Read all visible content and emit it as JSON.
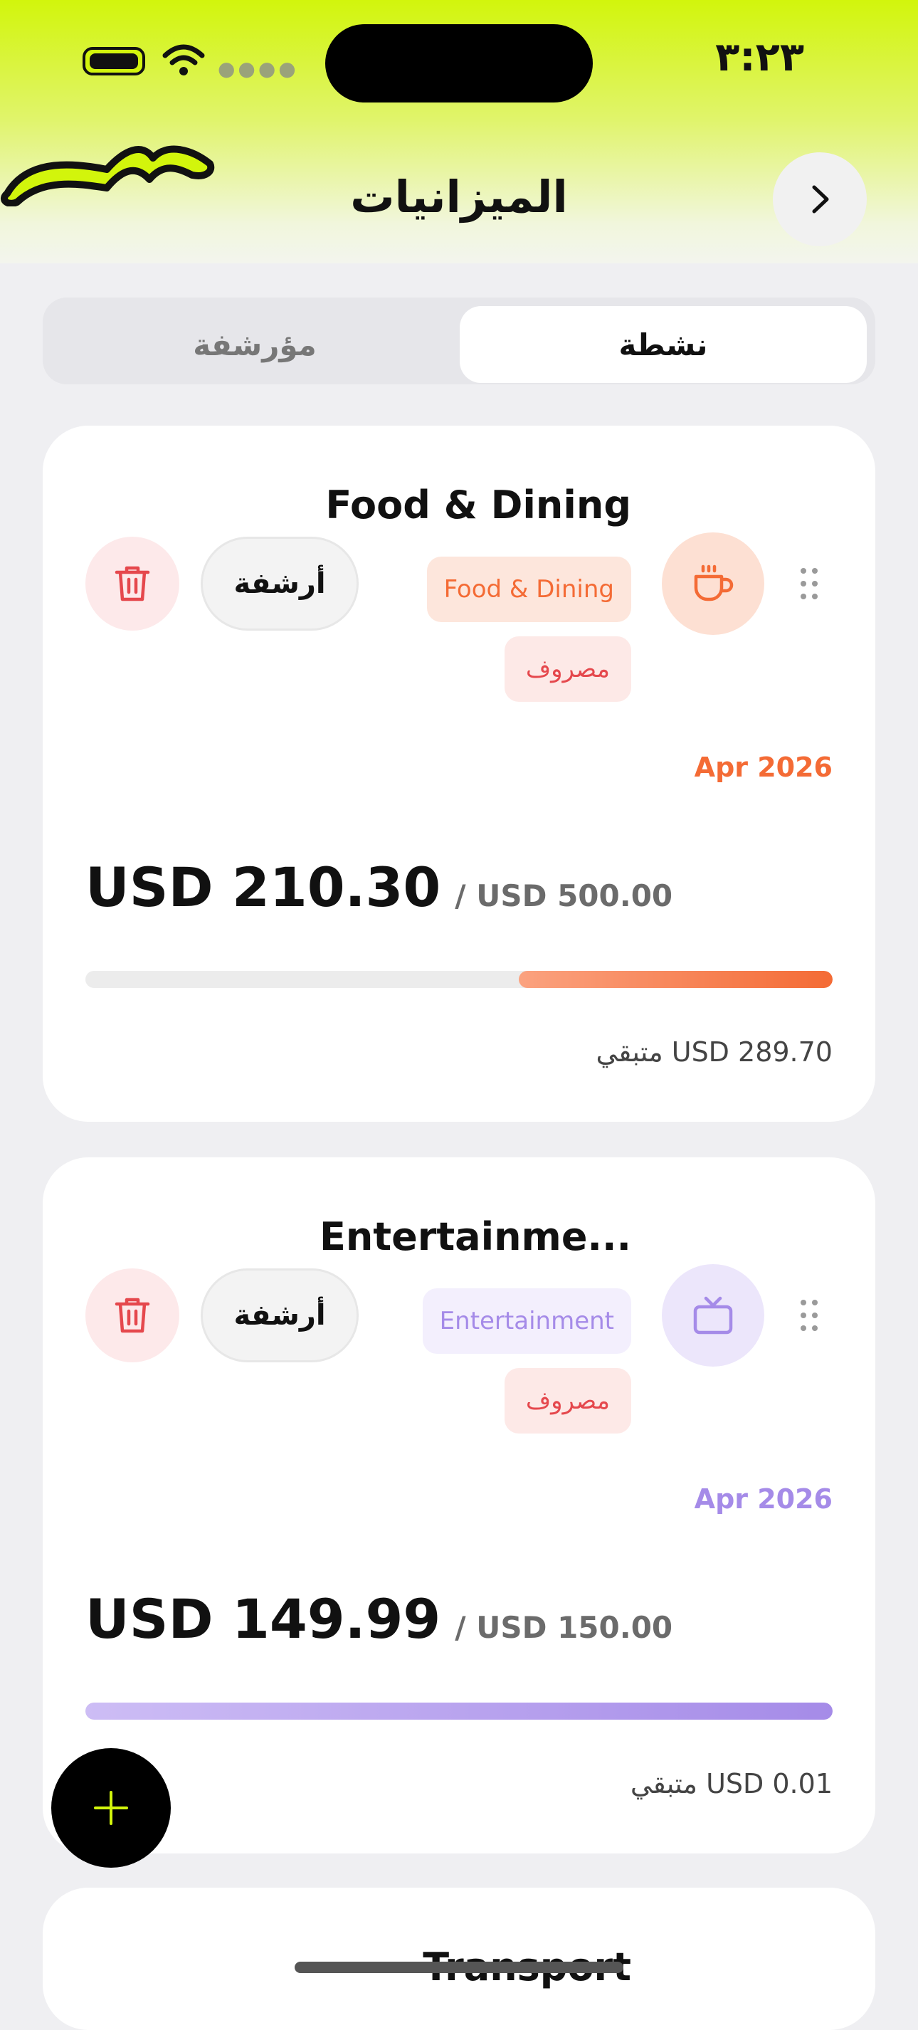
{
  "status_bar": {
    "time": "٣:٢٣"
  },
  "header": {
    "title": "الميزانيات"
  },
  "tabs": [
    {
      "label": "نشطة",
      "active": true
    },
    {
      "label": "مؤرشفة",
      "active": false
    }
  ],
  "budgets": [
    {
      "title": "Food & Dining",
      "category_chip": "Food & Dining",
      "type_chip": "مصروف",
      "icon": "coffee-cup-icon",
      "archive_label": "أرشفة",
      "period": "Apr 2026",
      "spent": "USD 210.30",
      "limit": "/ USD 500.00",
      "progress": 0.42,
      "remaining": "متبقي USD 289.70",
      "accent": "#f46b35"
    },
    {
      "title": "Entertainme...",
      "category_chip": "Entertainment",
      "type_chip": "مصروف",
      "icon": "tv-icon",
      "archive_label": "أرشفة",
      "period": "Apr 2026",
      "spent": "USD 149.99",
      "limit": "/ USD 150.00",
      "progress": 0.9999,
      "remaining": "متبقي USD 0.01",
      "accent": "#a58be8"
    },
    {
      "title": "Transport"
    }
  ],
  "colors": {
    "brand_lime": "#d2f50c",
    "delete_red": "#e5484d",
    "expense_chip_bg": "#fde9e7",
    "expense_chip_text": "#e5484d"
  }
}
